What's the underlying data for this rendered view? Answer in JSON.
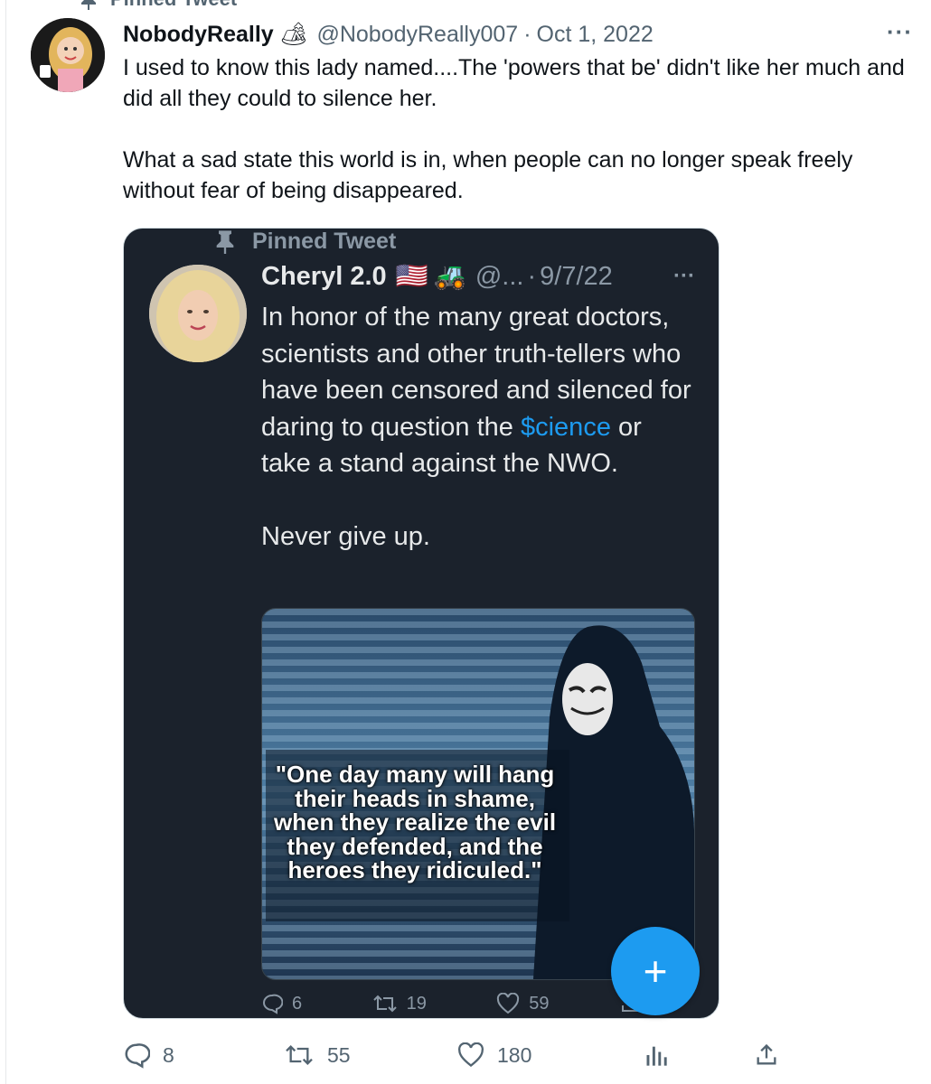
{
  "pinned_label": "Pinned Tweet",
  "tweet": {
    "author_name": "NobodyReally",
    "author_badge": "🏕",
    "handle": "@NobodyReally007",
    "separator": "·",
    "date": "Oct 1, 2022",
    "more": "···",
    "paragraph1": "I used to know this lady named....The 'powers that be' didn't like her much and did all they could to silence her.",
    "paragraph2": "What a sad state this world is in, when people can no longer speak freely without fear of being disappeared.",
    "replies": "8",
    "retweets": "55",
    "likes": "180"
  },
  "embedded": {
    "pinned_label": "Pinned Tweet",
    "author_name": "Cheryl 2.0",
    "flag": "🇺🇸",
    "tractor": "🚜",
    "handle": "@...",
    "separator": "·",
    "date": "9/7/22",
    "more": "···",
    "text_before": "In honor of the many great doctors, scientists and other truth-tellers who have been censored and silenced for daring to question the ",
    "text_link": "$cience",
    "text_after": " or take a stand against the NWO.",
    "text_2": "Never give up.",
    "image_quote": "\"One day many will hang their heads in shame, when they realize the evil they defended, and the heroes they ridiculed.\"",
    "replies": "6",
    "retweets": "19",
    "likes": "59"
  },
  "fab_label": "+",
  "colors": {
    "accent": "#1d9bf0",
    "card_bg": "#1b222c",
    "muted": "#536471"
  }
}
